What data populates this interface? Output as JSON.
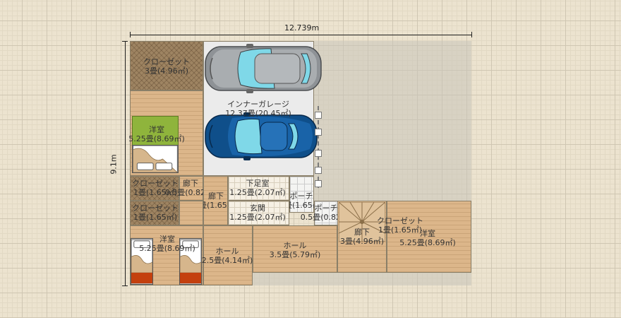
{
  "dimensions": {
    "width_label": "12.739m",
    "height_label": "9.1m"
  },
  "rooms": {
    "closet_top": {
      "name": "クローゼット",
      "area": "3畳(4.96㎡)"
    },
    "garage": {
      "name": "インナーガレージ",
      "area": "12.37畳(20.45㎡)"
    },
    "bedroom_upper": {
      "name": "洋室",
      "area": "5.25畳(8.69㎡)"
    },
    "closet_a": {
      "name": "クローゼット",
      "area": "1畳(1.65㎡)"
    },
    "corridor_a": {
      "name": "廊下",
      "area": "0.5畳(0.82㎡)"
    },
    "corridor_b": {
      "name": "廊下",
      "area": "1畳(1.65㎡)"
    },
    "shoe_room": {
      "name": "下足室",
      "area": "1.25畳(2.07㎡)"
    },
    "porch_a": {
      "name": "ポーチ",
      "area": "1畳(1.65㎡)"
    },
    "entrance": {
      "name": "玄関",
      "area": "1.25畳(2.07㎡)"
    },
    "porch_b": {
      "name": "ポーチ",
      "area": "0.5畳(0.82㎡)"
    },
    "closet_b": {
      "name": "クローゼット",
      "area": "1畳(1.65㎡)"
    },
    "bedroom_lower": {
      "name": "洋室",
      "area": "5.25畳(8.69㎡)"
    },
    "hall_small": {
      "name": "ホール",
      "area": "2.5畳(4.14㎡)"
    },
    "hall_large": {
      "name": "ホール",
      "area": "3.5畳(5.79㎡)"
    },
    "stair_corridor": {
      "name": "廊下",
      "area": "3畳(4.96㎡)"
    },
    "closet_c": {
      "name": "クローゼット",
      "area": "1畳(1.65㎡)"
    },
    "bedroom_right": {
      "name": "洋室",
      "area": "5.25畳(8.69㎡)"
    }
  },
  "colors": {
    "car_silver": "#8e9296",
    "car_blue": "#0f4f8a",
    "glass": "#7fd8e8",
    "bedroom_green": "#8fb43c",
    "blanket_red": "#c4400e"
  },
  "icons": [
    "silver-car-icon",
    "blue-car-icon",
    "bed-icon",
    "staircase-icon"
  ]
}
